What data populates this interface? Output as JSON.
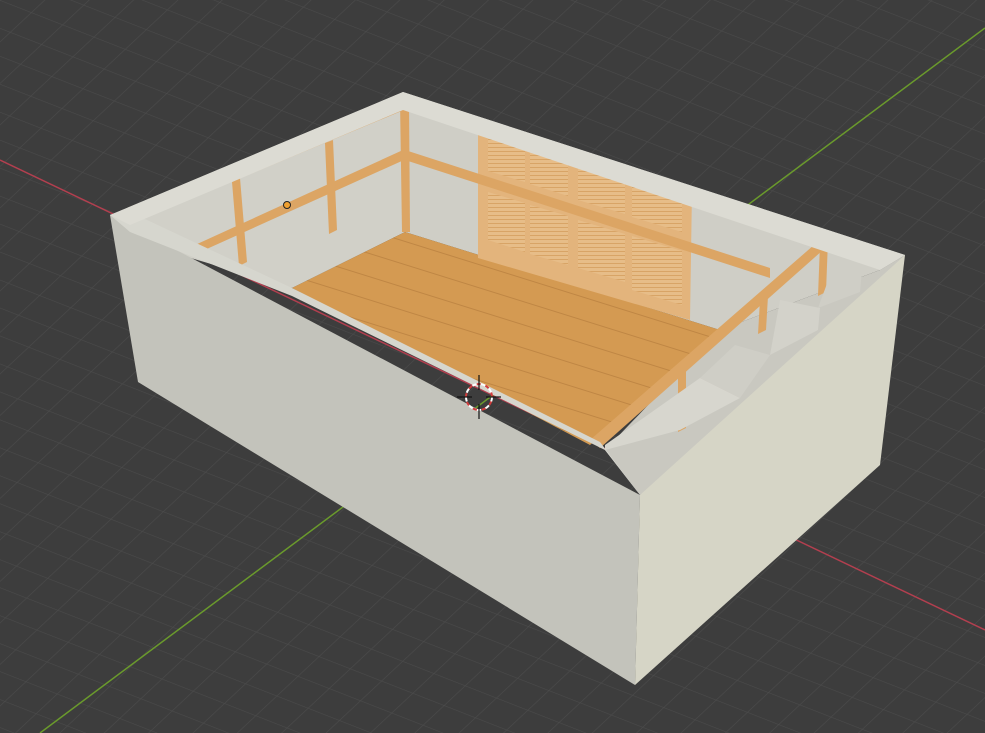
{
  "viewport": {
    "background": "#3d3d3d",
    "grid_color": "#4a4a4a",
    "x_axis_color": "#b33f4f",
    "y_axis_color": "#6a9a2c"
  },
  "scene": {
    "wall_color": "#c4c4bc",
    "wall_shadow_color": "#b3b3ab",
    "wall_light_color": "#d6d5c6",
    "wood_color": "#d9a05c",
    "floor_color": "#d49a52",
    "shoji_color": "#e3b47c"
  },
  "overlays": {
    "origin_icon": "origin-dot-icon",
    "cursor_icon": "3d-cursor-icon"
  }
}
